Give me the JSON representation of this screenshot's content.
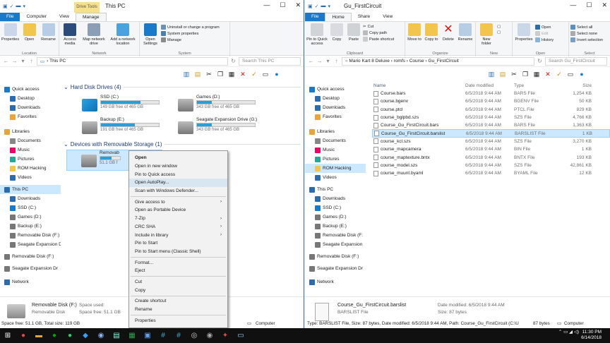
{
  "left": {
    "ctx_tab": "Drive Tools",
    "title": "This PC",
    "tabs": [
      "File",
      "Computer",
      "View",
      "Manage"
    ],
    "ribbon": {
      "location": {
        "label": "Location",
        "items": [
          "Properties",
          "Open",
          "Rename"
        ]
      },
      "network": {
        "label": "Network",
        "items": [
          "Access media",
          "Map network drive",
          "Add a network location"
        ]
      },
      "system": {
        "label": "System",
        "big": "Open Settings",
        "small": [
          "Uninstall or change a program",
          "System properties",
          "Manage"
        ]
      }
    },
    "address": "This PC",
    "search_placeholder": "Search This PC",
    "nav": [
      "Quick access",
      "Desktop",
      "Downloads",
      "Favorites",
      "Libraries",
      "Documents",
      "Music",
      "Pictures",
      "ROM Hacking",
      "Videos",
      "This PC",
      "Downloads",
      "SSD (C:)",
      "Games (D:)",
      "Backup (E:)",
      "Removable Disk (F:)",
      "Seagate Expansion D",
      "Removable Disk (F:)",
      "Seagate Expansion Dr",
      "Network"
    ],
    "sections": {
      "hdd": "Hard Disk Drives (4)",
      "removable": "Devices with Removable Storage (1)"
    },
    "drives": [
      {
        "name": "SSD (C:)",
        "free": "149 GB free of 465 GB",
        "used": 0.68
      },
      {
        "name": "Games (D:)",
        "free": "343 GB free of 465 GB",
        "used": 0.26
      },
      {
        "name": "Backup (E:)",
        "free": "191 GB free of 465 GB",
        "used": 0.59
      },
      {
        "name": "Seagate Expansion Drive (G:)",
        "free": "343 GB free of 465 GB",
        "used": 0.26
      }
    ],
    "removable_drive": {
      "name": "Removab",
      "free": "51.1 GB f"
    },
    "details": {
      "name": "Removable Disk (F:)",
      "type": "Removable Disk",
      "used_label": "Space used:",
      "free_label": "Space free: 51.1 GB"
    },
    "status": "Space free: 51.1 GB, Total size: 119 GB",
    "status_right": "Computer"
  },
  "context_menu": {
    "groups": [
      [
        "Open",
        "Open in new window",
        "Pin to Quick access",
        "Open AutoPlay...",
        "Scan with Windows Defender..."
      ],
      [
        "Give access to",
        "Open as Portable Device",
        "7-Zip",
        "CRC SHA",
        "Include in library",
        "Pin to Start",
        "Pin to Start menu (Classic Shell)"
      ],
      [
        "Format...",
        "Eject"
      ],
      [
        "Cut",
        "Copy"
      ],
      [
        "Create shortcut",
        "Rename"
      ],
      [
        "Properties"
      ]
    ]
  },
  "right": {
    "title": "Gu_FirstCircuit",
    "tabs": [
      "File",
      "Home",
      "Share",
      "View"
    ],
    "ribbon": {
      "clipboard": {
        "label": "Clipboard",
        "big": [
          "Pin to Quick access",
          "Copy",
          "Paste"
        ],
        "small": [
          "Cut",
          "Copy path",
          "Paste shortcut"
        ]
      },
      "organize": {
        "label": "Organize",
        "items": [
          "Move to",
          "Copy to",
          "Delete",
          "Rename"
        ]
      },
      "new": {
        "label": "New",
        "items": [
          "New folder"
        ]
      },
      "open": {
        "label": "Open",
        "big": "Properties",
        "small": [
          "Open",
          "Edit",
          "History"
        ]
      },
      "select": {
        "label": "Select",
        "small": [
          "Select all",
          "Select none",
          "Invert selection"
        ]
      }
    },
    "breadcrumb": [
      "Mario Kart 8 Deluxe",
      "romfs",
      "Course",
      "Gu_FirstCircuit"
    ],
    "search_placeholder": "Search Gu_FirstCircuit",
    "nav": [
      "Quick access",
      "Desktop",
      "Downloads",
      "Favorites",
      "Libraries",
      "Documents",
      "Music",
      "Pictures",
      "ROM Hacking",
      "Videos",
      "This PC",
      "Downloads",
      "SSD (C:)",
      "Games (D:)",
      "Backup (E:)",
      "Removable Disk (F:",
      "Seagate Expansion",
      "Removable Disk (F:)",
      "Seagate Expansion Dr",
      "Network"
    ],
    "columns": [
      "Name",
      "Date modified",
      "Type",
      "Size"
    ],
    "files": [
      {
        "name": "Course.bars",
        "date": "6/5/2018 9:44 AM",
        "type": "BARS File",
        "size": "1,254 KB"
      },
      {
        "name": "course.bgenv",
        "date": "6/5/2018 9:44 AM",
        "type": "BGENV File",
        "size": "50 KB"
      },
      {
        "name": "course.ptcl",
        "date": "6/5/2018 9:44 AM",
        "type": "PTCL File",
        "size": "829 KB"
      },
      {
        "name": "course_bglpbd.szs",
        "date": "6/5/2018 9:44 AM",
        "type": "SZS File",
        "size": "4,766 KB"
      },
      {
        "name": "Course_Gu_FirstCircuit.bars",
        "date": "6/5/2018 9:44 AM",
        "type": "BARS File",
        "size": "1,363 KB"
      },
      {
        "name": "Course_Gu_FirstCircuit.barslist",
        "date": "6/5/2018 9:44 AM",
        "type": "BARSLIST File",
        "size": "1 KB"
      },
      {
        "name": "course_kcl.szs",
        "date": "6/5/2018 9:44 AM",
        "type": "SZS File",
        "size": "3,270 KB"
      },
      {
        "name": "course_mapcamera",
        "date": "6/5/2018 9:44 AM",
        "type": "BIN File",
        "size": "1 KB"
      },
      {
        "name": "course_maptexture.bntx",
        "date": "6/5/2018 9:44 AM",
        "type": "BNTX File",
        "size": "193 KB"
      },
      {
        "name": "course_model.szs",
        "date": "6/5/2018 9:44 AM",
        "type": "SZS File",
        "size": "42,861 KB"
      },
      {
        "name": "course_muunt.byaml",
        "date": "6/5/2018 9:44 AM",
        "type": "BYAML File",
        "size": "12 KB"
      }
    ],
    "details": {
      "name": "Course_Gu_FirstCircuit.barslist",
      "type": "BARSLIST File",
      "date": "Date modified: 6/5/2018 9:44 AM",
      "size": "Size: 87 bytes"
    },
    "status": "Type: BARSLIST File, Size: 87 bytes, Date modified: 6/5/2018 9:44 AM, Path: Course_Gu_FirstCircuit (C:\\Use",
    "status_right": "87 bytes",
    "status_right2": "Computer"
  },
  "taskbar": {
    "time": "11:30 PM",
    "date": "6/14/2018"
  },
  "colors": {
    "accent": "#1979ca",
    "bar": "#26a0da",
    "selection": "#cce8ff"
  }
}
